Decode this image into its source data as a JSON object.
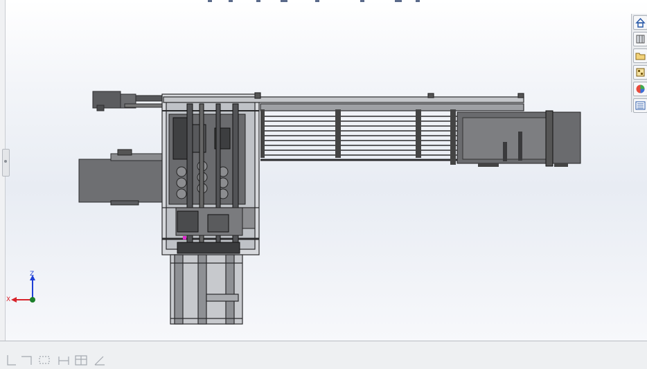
{
  "triad": {
    "z_label": "Z",
    "x_label": "X"
  },
  "taskpane": {
    "icons": [
      "home-icon",
      "3d-parts-library-icon",
      "file-explorer-icon",
      "view-palette-icon",
      "appearances-icon",
      "custom-properties-icon"
    ]
  },
  "statusbar": {
    "icons": [
      "sketch-line-icon",
      "sketch-rectangle-icon",
      "smart-dimension-icon",
      "table-icon",
      "angle-icon"
    ]
  },
  "colors": {
    "model_dark": "#4a4b4d",
    "model_mid": "#707275",
    "axis_z": "#1f3fd6",
    "axis_x": "#d8232a",
    "origin": "#1b7f2a"
  }
}
